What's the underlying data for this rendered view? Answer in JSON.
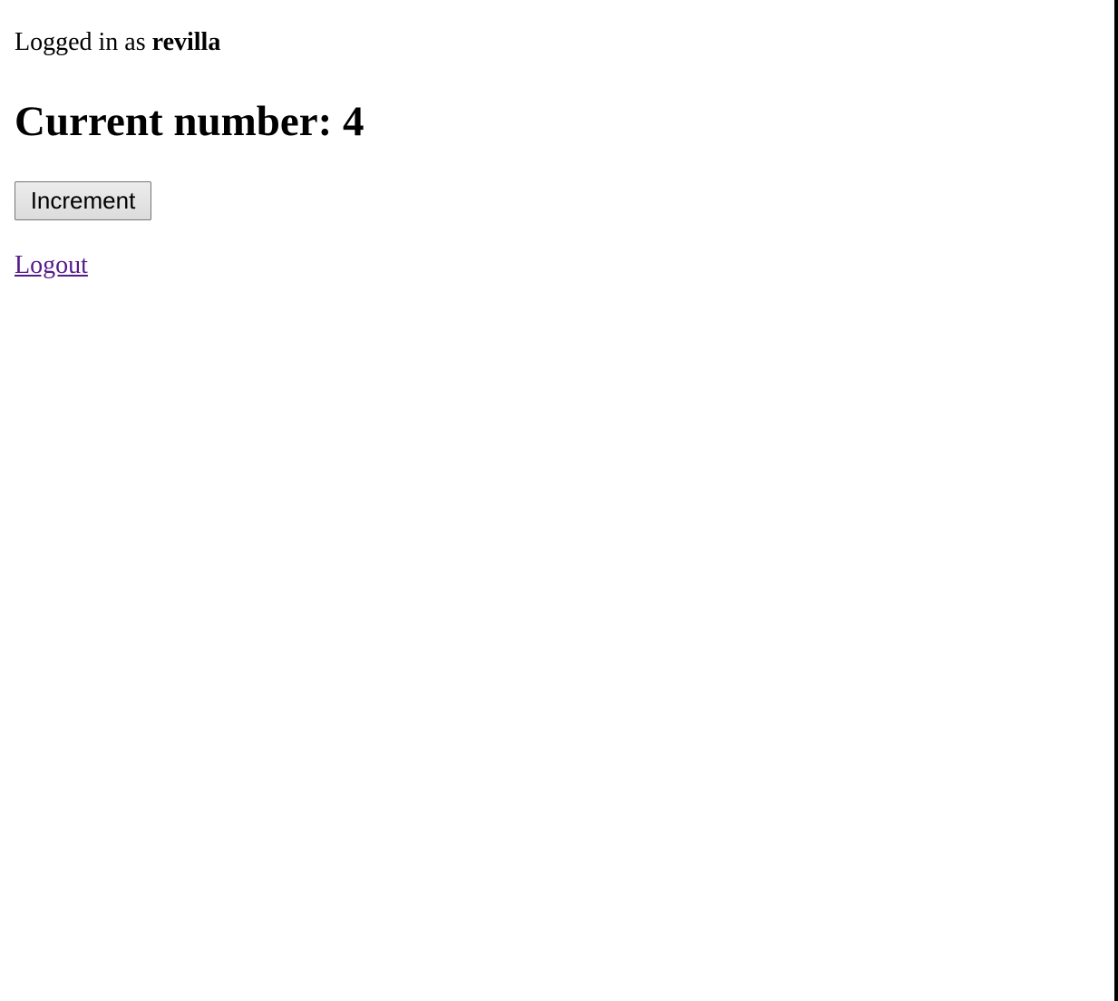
{
  "status": {
    "prefix": "Logged in as",
    "username": "revilla"
  },
  "counter": {
    "label": "Current number:",
    "value": "4"
  },
  "actions": {
    "increment_label": "Increment",
    "logout_label": "Logout"
  },
  "colors": {
    "visited_link": "#551a8b"
  }
}
